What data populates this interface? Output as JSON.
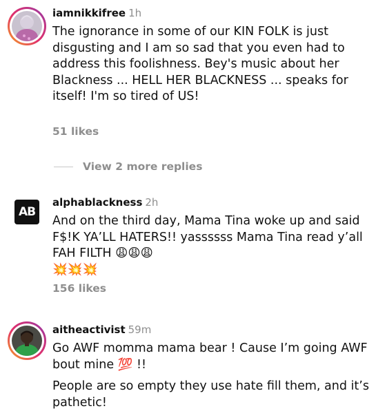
{
  "comments": [
    {
      "username": "iamnikkifree",
      "time": "1h",
      "text": "The ignorance in some of our KIN FOLK is just disgusting and I am so sad that you even had to address this foolishness. Bey's music about her Blackness ... HELL HER BLACKNESS ... speaks for itself! I'm so tired of US!",
      "likes": "51 likes",
      "avatar": "user-photo-avatar"
    },
    {
      "username": "alphablackness",
      "time": "2h",
      "text": "And on the third day, Mama Tina woke up and said F$!K YA’LL HATERS!! yassssss Mama Tina read y’all FAH FILTH 😩😩😩",
      "emoji_line": "💥💥💥",
      "likes": "156 likes",
      "avatar_text": "AB"
    },
    {
      "username": "aitheactivist",
      "time": "59m",
      "text": "Go AWF momma mama bear ! Cause I’m going AWF bout mine 💯 !!",
      "text2": "People are so empty they use hate fill them, and it’s pathetic!",
      "avatar": "user-photo-avatar"
    }
  ],
  "view_replies": "View 2 more replies",
  "colors": {
    "text": "#111111",
    "muted": "#8e8e8e",
    "story_ring": [
      "#f5a623",
      "#e1306c",
      "#833ab4"
    ]
  }
}
